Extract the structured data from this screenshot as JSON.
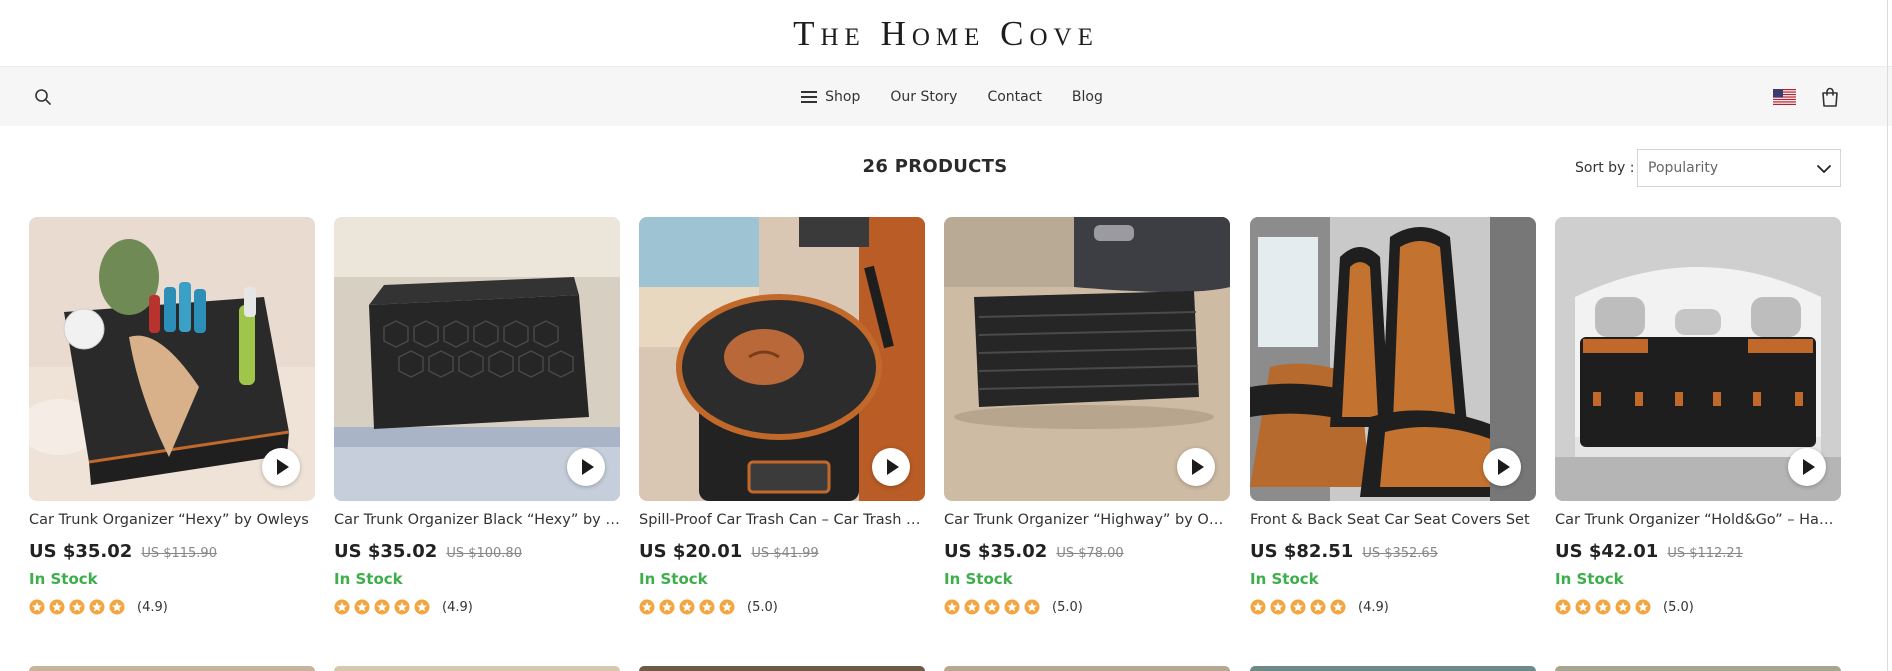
{
  "brand": {
    "name": "The Home Cove"
  },
  "nav": {
    "items": [
      {
        "label": "Shop",
        "icon": "hamburger-menu-icon"
      },
      {
        "label": "Our Story"
      },
      {
        "label": "Contact"
      },
      {
        "label": "Blog"
      }
    ],
    "icons": {
      "search": "search-icon",
      "flag": "us-flag-icon",
      "cart": "shopping-bag-icon"
    }
  },
  "toolbar": {
    "product_count": "26 PRODUCTS",
    "sort_label": "Sort by :",
    "sort_value": "Popularity"
  },
  "products": [
    {
      "title": "Car Trunk Organizer “Hexy” by Owleys",
      "price": "US $35.02",
      "was": "US $115.90",
      "stock": "In Stock",
      "rating": "(4.9)",
      "stars": 5
    },
    {
      "title": "Car Trunk Organizer Black “Hexy” by Owleys",
      "price": "US $35.02",
      "was": "US $100.80",
      "stock": "In Stock",
      "rating": "(4.9)",
      "stars": 5
    },
    {
      "title": "Spill-Proof Car Trash Can – Car Trash Bag by Owleys",
      "price": "US $20.01",
      "was": "US $41.99",
      "stock": "In Stock",
      "rating": "(5.0)",
      "stars": 5
    },
    {
      "title": "Car Trunk Organizer “Highway” by Owleys",
      "price": "US $35.02",
      "was": "US $78.00",
      "stock": "In Stock",
      "rating": "(5.0)",
      "stars": 5
    },
    {
      "title": "Front & Back Seat Car Seat Covers Set",
      "price": "US $82.51",
      "was": "US $352.65",
      "stock": "In Stock",
      "rating": "(4.9)",
      "stars": 5
    },
    {
      "title": "Car Trunk Organizer “Hold&Go” – Hanging Trunk Organizer",
      "price": "US $42.01",
      "was": "US $112.21",
      "stock": "In Stock",
      "rating": "(5.0)",
      "stars": 5
    }
  ],
  "colors": {
    "accent_orange": "#c0692b",
    "in_stock_green": "#3dae4b",
    "star": "#f2a541",
    "nav_bg": "#f6f6f6"
  }
}
